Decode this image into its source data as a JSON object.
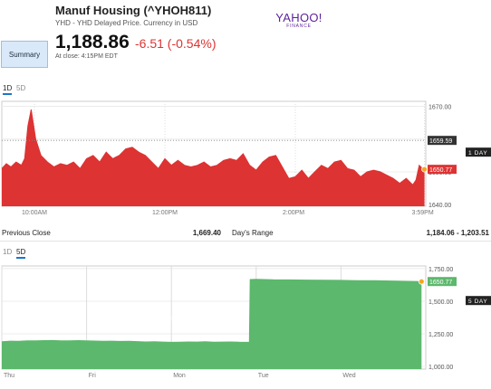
{
  "header": {
    "title": "Manuf Housing (^YHOH811)",
    "subtitle": "YHD - YHD Delayed Price. Currency in USD",
    "logo_word": "YAHOO!",
    "logo_sub": "FINANCE"
  },
  "nav": {
    "summary_label": "Summary"
  },
  "quote": {
    "price": "1,188.86",
    "change": "-6.51 (-0.54%)",
    "close_time": "At close: 4:15PM EDT"
  },
  "stats": {
    "prev_close_label": "Previous Close",
    "prev_close_value": "1,669.40",
    "days_range_label": "Day's Range",
    "days_range_value": "1,184.06 - 1,203.51"
  },
  "colors": {
    "down": "#dd3333",
    "up": "#5cb86c",
    "accent": "#1b77c9"
  },
  "chart_data": [
    {
      "type": "area",
      "tabs": [
        "1D",
        "5D"
      ],
      "active_tab": "1D",
      "watermark": "YAHOO! FINANCE",
      "x_ticks": [
        {
          "label": "10:00AM",
          "t": 0.5
        },
        {
          "label": "12:00PM",
          "t": 2.5
        },
        {
          "label": "2:00PM",
          "t": 4.5
        },
        {
          "label": "3:59PM",
          "t": 6.48
        }
      ],
      "y_ticks": [
        1640,
        1650,
        1660,
        1670
      ],
      "ylim": [
        1639.5,
        1671.5
      ],
      "xlim": [
        0,
        6.5
      ],
      "reference_line": {
        "value": 1659.59,
        "label": "1659.59",
        "color": "#333333"
      },
      "last_value": {
        "value": 1650.77,
        "label": "1650.77",
        "color": "#dd3333"
      },
      "range_label": "1 DAY",
      "grid": true,
      "series": [
        {
          "color": "#dd3333",
          "x": [
            0,
            0.07,
            0.14,
            0.22,
            0.3,
            0.35,
            0.4,
            0.45,
            0.52,
            0.6,
            0.7,
            0.8,
            0.9,
            1.0,
            1.1,
            1.2,
            1.3,
            1.4,
            1.5,
            1.6,
            1.7,
            1.8,
            1.9,
            2.0,
            2.1,
            2.2,
            2.3,
            2.4,
            2.5,
            2.6,
            2.7,
            2.8,
            2.9,
            3.0,
            3.1,
            3.2,
            3.3,
            3.4,
            3.5,
            3.6,
            3.7,
            3.8,
            3.9,
            4.0,
            4.1,
            4.2,
            4.3,
            4.4,
            4.5,
            4.6,
            4.7,
            4.8,
            4.9,
            5.0,
            5.1,
            5.2,
            5.3,
            5.4,
            5.5,
            5.6,
            5.7,
            5.8,
            5.9,
            6.0,
            6.1,
            6.2,
            6.3,
            6.35,
            6.4,
            6.45,
            6.48
          ],
          "values": [
            1651,
            1652.5,
            1651.5,
            1653,
            1652,
            1654,
            1664,
            1669,
            1660,
            1655,
            1653,
            1651.5,
            1652.5,
            1652,
            1653,
            1651,
            1654,
            1655,
            1653,
            1656,
            1654,
            1655,
            1657,
            1657.5,
            1656,
            1655,
            1653,
            1651,
            1654,
            1652,
            1653.5,
            1652,
            1651.5,
            1652,
            1653,
            1651.5,
            1652,
            1653.5,
            1654,
            1653.5,
            1655.5,
            1652,
            1650.5,
            1653,
            1654.5,
            1655,
            1651.5,
            1648,
            1648.5,
            1650.5,
            1648,
            1650,
            1652,
            1651,
            1653,
            1653.5,
            1651,
            1650.5,
            1648.5,
            1650,
            1650.5,
            1650,
            1649,
            1648,
            1646.5,
            1648,
            1646,
            1647.5,
            1652,
            1651,
            1650.77
          ]
        }
      ]
    },
    {
      "type": "area",
      "tabs": [
        "1D",
        "5D"
      ],
      "active_tab": "5D",
      "watermark": "YAHOO! FINANCE",
      "x_ticks": [
        {
          "label": "Thu",
          "t": 0
        },
        {
          "label": "Fri",
          "t": 1
        },
        {
          "label": "Mon",
          "t": 2
        },
        {
          "label": "Tue",
          "t": 3
        },
        {
          "label": "Wed",
          "t": 4
        }
      ],
      "y_ticks": [
        1000,
        1250,
        1500,
        1750
      ],
      "ylim": [
        980,
        1770
      ],
      "xlim": [
        0,
        5
      ],
      "last_value": {
        "value": 1650.77,
        "label": "1650.77",
        "color": "#5cb86c"
      },
      "range_label": "5 DAY",
      "grid": true,
      "series": [
        {
          "color": "#5cb86c",
          "x": [
            0,
            0.1,
            0.2,
            0.3,
            0.4,
            0.5,
            0.6,
            0.7,
            0.8,
            0.9,
            1.0,
            1.1,
            1.2,
            1.3,
            1.4,
            1.5,
            1.6,
            1.7,
            1.8,
            1.9,
            2.0,
            2.1,
            2.2,
            2.3,
            2.4,
            2.5,
            2.6,
            2.7,
            2.8,
            2.92,
            2.93,
            3.0,
            3.2,
            3.4,
            3.6,
            3.8,
            4.0,
            4.2,
            4.4,
            4.6,
            4.8,
            4.95
          ],
          "values": [
            1190,
            1194,
            1193,
            1197,
            1196,
            1198,
            1199,
            1197,
            1196,
            1198,
            1196,
            1195,
            1193,
            1194,
            1192,
            1193,
            1191,
            1188,
            1190,
            1187,
            1185,
            1186,
            1188,
            1187,
            1189,
            1186,
            1187,
            1188,
            1186,
            1185,
            1666,
            1668,
            1664,
            1663,
            1662,
            1661,
            1660,
            1657,
            1658,
            1655,
            1652,
            1650.77
          ]
        }
      ]
    }
  ]
}
